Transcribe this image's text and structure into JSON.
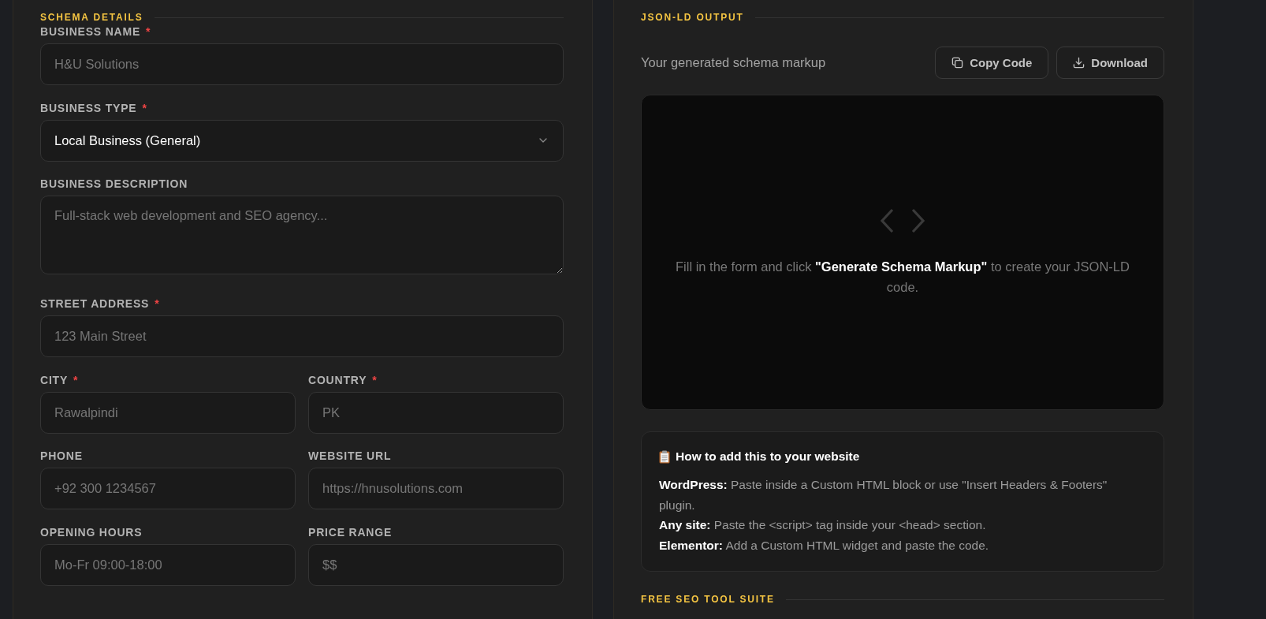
{
  "schema_details": {
    "title": "SCHEMA DETAILS",
    "rows": [
      [
        {
          "label": "BUSINESS NAME",
          "required_mark": "*",
          "kind": "input",
          "placeholder": "H&U Solutions"
        }
      ],
      [
        {
          "label": "BUSINESS TYPE",
          "required_mark": "*",
          "kind": "select",
          "value": "Local Business (General)"
        }
      ],
      [
        {
          "label": "BUSINESS DESCRIPTION",
          "kind": "textarea",
          "placeholder": "Full-stack web development and SEO agency..."
        }
      ],
      [
        {
          "label": "STREET ADDRESS",
          "required_mark": "*",
          "kind": "input",
          "placeholder": "123 Main Street"
        }
      ],
      [
        {
          "label": "CITY",
          "required_mark": "*",
          "kind": "input",
          "placeholder": "Rawalpindi"
        },
        {
          "label": "COUNTRY",
          "required_mark": "*",
          "kind": "input",
          "placeholder": "PK"
        }
      ],
      [
        {
          "label": "PHONE",
          "kind": "input",
          "placeholder": "+92 300 1234567"
        },
        {
          "label": "WEBSITE URL",
          "kind": "input",
          "placeholder": "https://hnusolutions.com"
        }
      ],
      [
        {
          "label": "OPENING HOURS",
          "kind": "input",
          "placeholder": "Mo-Fr 09:00-18:00"
        },
        {
          "label": "PRICE RANGE",
          "kind": "input",
          "placeholder": "$$"
        }
      ]
    ]
  },
  "json_ld_output": {
    "title": "JSON-LD OUTPUT",
    "subtitle": "Your generated schema markup",
    "buttons": [
      {
        "label": "Copy Code",
        "kind": "copy"
      },
      {
        "label": "Download",
        "kind": "download"
      }
    ],
    "empty_message": "Fill in the form and click **\"Generate Schema Markup\"** to create your JSON-LD code.",
    "instructions": {
      "title": "How to add this to your website",
      "lines": [
        "**WordPress:** Paste inside a Custom HTML block or use \"Insert Headers & Footers\" plugin.",
        "**Any site:** Paste the <script> tag inside your <head> section.",
        "**Elementor:** Add a Custom HTML widget and paste the code."
      ]
    },
    "next_section": {
      "title": "FREE SEO TOOL SUITE"
    }
  }
}
